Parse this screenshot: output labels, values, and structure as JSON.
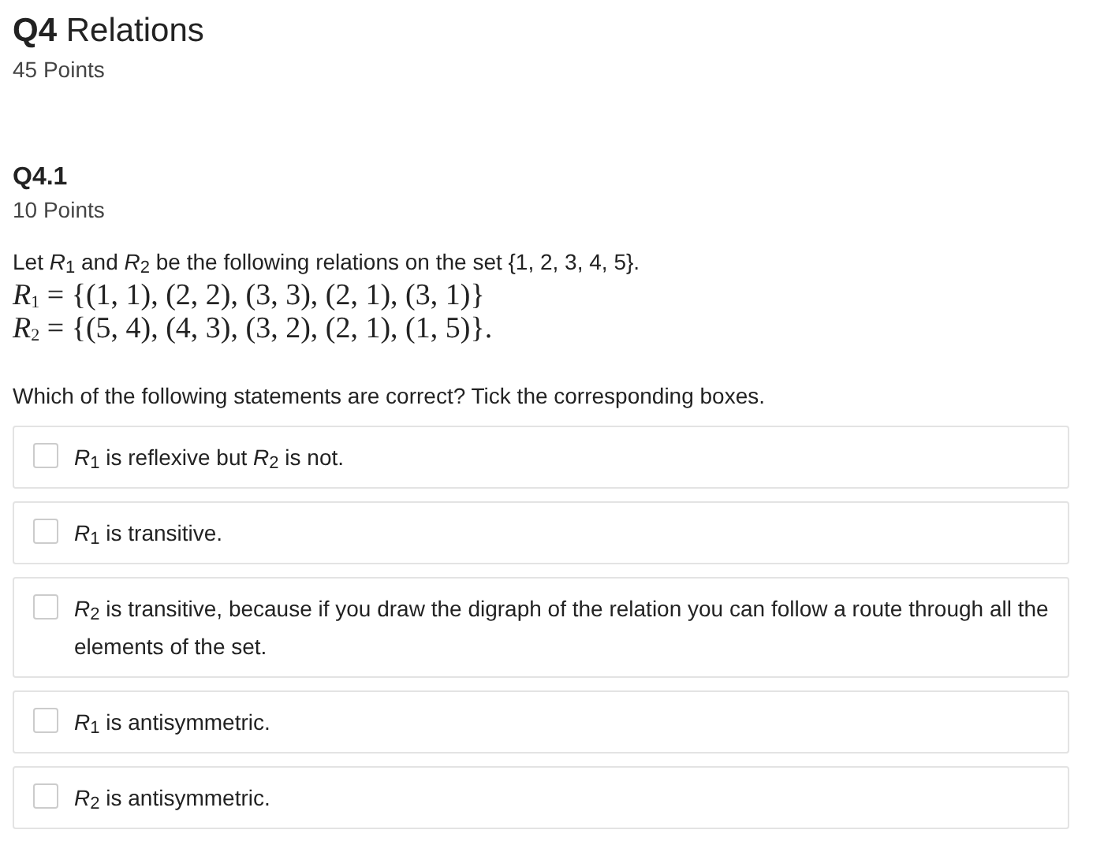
{
  "question": {
    "title": "**Q4** Relations",
    "points": "45 Points"
  },
  "subquestion": {
    "title": "Q4.1",
    "points": "10 Points",
    "intro": "Let *R*$_{1}$ and *R*$_{2}$ be the following relations on the set {1, 2, 3, 4, 5}.",
    "definitions": [
      "*R*$_{1}$ = {(1, 1), (2, 2), (3, 3), (2, 1), (3, 1)}",
      "*R*$_{2}$ = {(5, 4), (4, 3), (3, 2), (2, 1), (1, 5)}."
    ],
    "prompt": "Which of the following statements are correct? Tick the corresponding boxes.",
    "options": [
      {
        "text": "*R*$_{1}$ is reflexive but *R*$_{2}$ is not.",
        "checked": false
      },
      {
        "text": "*R*$_{1}$ is transitive.",
        "checked": false
      },
      {
        "text": "*R*$_{2}$ is transitive, because if you draw the digraph of the relation you can follow a route through all the elements of the set.",
        "checked": false
      },
      {
        "text": "*R*$_{1}$ is antisymmetric.",
        "checked": false
      },
      {
        "text": "*R*$_{2}$ is antisymmetric.",
        "checked": false
      }
    ]
  }
}
